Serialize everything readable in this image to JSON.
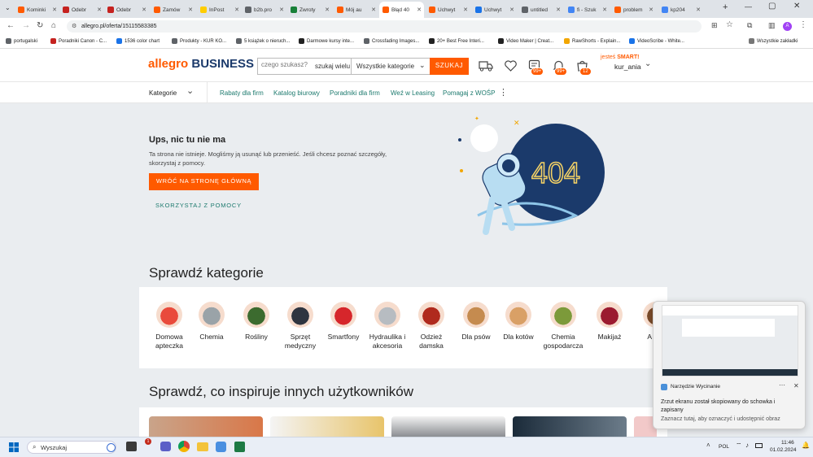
{
  "tabs": [
    {
      "label": "Kominki",
      "color": "#ff5a00"
    },
    {
      "label": "Odebr",
      "color": "#c5221f"
    },
    {
      "label": "Odebr",
      "color": "#c5221f"
    },
    {
      "label": "Zamów",
      "color": "#ff5a00"
    },
    {
      "label": "InPost",
      "color": "#ffcd00"
    },
    {
      "label": "b2b.pro",
      "color": "#5f6368"
    },
    {
      "label": "Zwroty",
      "color": "#188038"
    },
    {
      "label": "Mój au",
      "color": "#ff5a00"
    },
    {
      "label": "Błąd 40",
      "color": "#ff5a00"
    },
    {
      "label": "Uchwyt",
      "color": "#ff5a00"
    },
    {
      "label": "Uchwyt",
      "color": "#1a73e8"
    },
    {
      "label": "untitled",
      "color": "#5f6368"
    },
    {
      "label": "fi - Szuk",
      "color": "#4285f4"
    },
    {
      "label": "problem",
      "color": "#ff5a00"
    },
    {
      "label": "kp204",
      "color": "#4285f4"
    }
  ],
  "url": "allegro.pl/oferta/15115583385",
  "bookmarks": [
    {
      "label": "portugalski",
      "color": "#5f6368"
    },
    {
      "label": "Poradniki Canon - C...",
      "color": "#c5221f"
    },
    {
      "label": "1536 color chart",
      "color": "#1a73e8"
    },
    {
      "label": "Produkty - KUR KO...",
      "color": "#5f6368"
    },
    {
      "label": "5 książek o nieruch...",
      "color": "#5f6368"
    },
    {
      "label": "Darmowe kursy inte...",
      "color": "#222"
    },
    {
      "label": "Crossfading Images...",
      "color": "#5f6368"
    },
    {
      "label": "20+ Best Free Interi...",
      "color": "#222"
    },
    {
      "label": "Video Maker | Creat...",
      "color": "#222"
    },
    {
      "label": "RawShorts - Explain...",
      "color": "#f2a600"
    },
    {
      "label": "VideoScribe - White...",
      "color": "#1a73e8"
    }
  ],
  "bookmarks_all": "Wszystkie zakładki",
  "header": {
    "logo_a": "allegro",
    "logo_b": "BUSINESS",
    "search_placeholder": "czego szukasz?",
    "search_wide": "szukaj wielu",
    "category_select": "Wszystkie kategorie",
    "search_button": "SZUKAJ",
    "badge_msgs": "99+",
    "badge_notif": "99+",
    "badge_cart": "12",
    "smart_prefix": "jesteś",
    "smart": "SMART!",
    "username": "kur_ania"
  },
  "nav": {
    "kategorie": "Kategorie",
    "links": [
      "Rabaty dla firm",
      "Katalog biurowy",
      "Poradniki dla firm",
      "Weź w Leasing",
      "Pomagaj z WOŚP"
    ]
  },
  "error": {
    "title": "Ups, nic tu nie ma",
    "text": "Ta strona nie istnieje. Mogliśmy ją usunąć lub przenieść. Jeśli chcesz poznać szczegóły, skorzystaj z pomocy.",
    "button": "WRÓĆ NA STRONĘ GŁÓWNĄ",
    "help": "SKORZYSTAJ Z POMOCY",
    "illustration_text": "404"
  },
  "categories_title": "Sprawdź kategorie",
  "categories": [
    {
      "label": "Domowa apteczka",
      "color": "#e94b3c"
    },
    {
      "label": "Chemia",
      "color": "#9aa3a8"
    },
    {
      "label": "Rośliny",
      "color": "#3c6b2f"
    },
    {
      "label": "Sprzęt medyczny",
      "color": "#2f3540"
    },
    {
      "label": "Smartfony",
      "color": "#d6262b"
    },
    {
      "label": "Hydraulika i akcesoria",
      "color": "#b7bcc1"
    },
    {
      "label": "Odzież damska",
      "color": "#b02a1d"
    },
    {
      "label": "Dla psów",
      "color": "#c58b4f"
    },
    {
      "label": "Dla kotów",
      "color": "#d9a066"
    },
    {
      "label": "Chemia gospodarcza",
      "color": "#7c9a3a"
    },
    {
      "label": "Makijaż",
      "color": "#9b1b30"
    },
    {
      "label": "A Dro",
      "color": "#7a4b2a"
    }
  ],
  "inspire_title": "Sprawdź, co inspiruje innych użytkowników",
  "notification": {
    "app": "Narzędzie Wycinanie",
    "line1": "Zrzut ekranu został skopiowany do schowka i zapisany",
    "line2": "Zaznacz tutaj, aby oznaczyć i udostępnić obraz"
  },
  "taskbar": {
    "search": "Wyszukaj",
    "lang": "POL",
    "time": "11:46",
    "date": "01.02.2024",
    "badge": "1"
  },
  "colors": {
    "accent": "#ff5a00",
    "teal": "#1d7a6e",
    "navy": "#1b3a6b"
  }
}
